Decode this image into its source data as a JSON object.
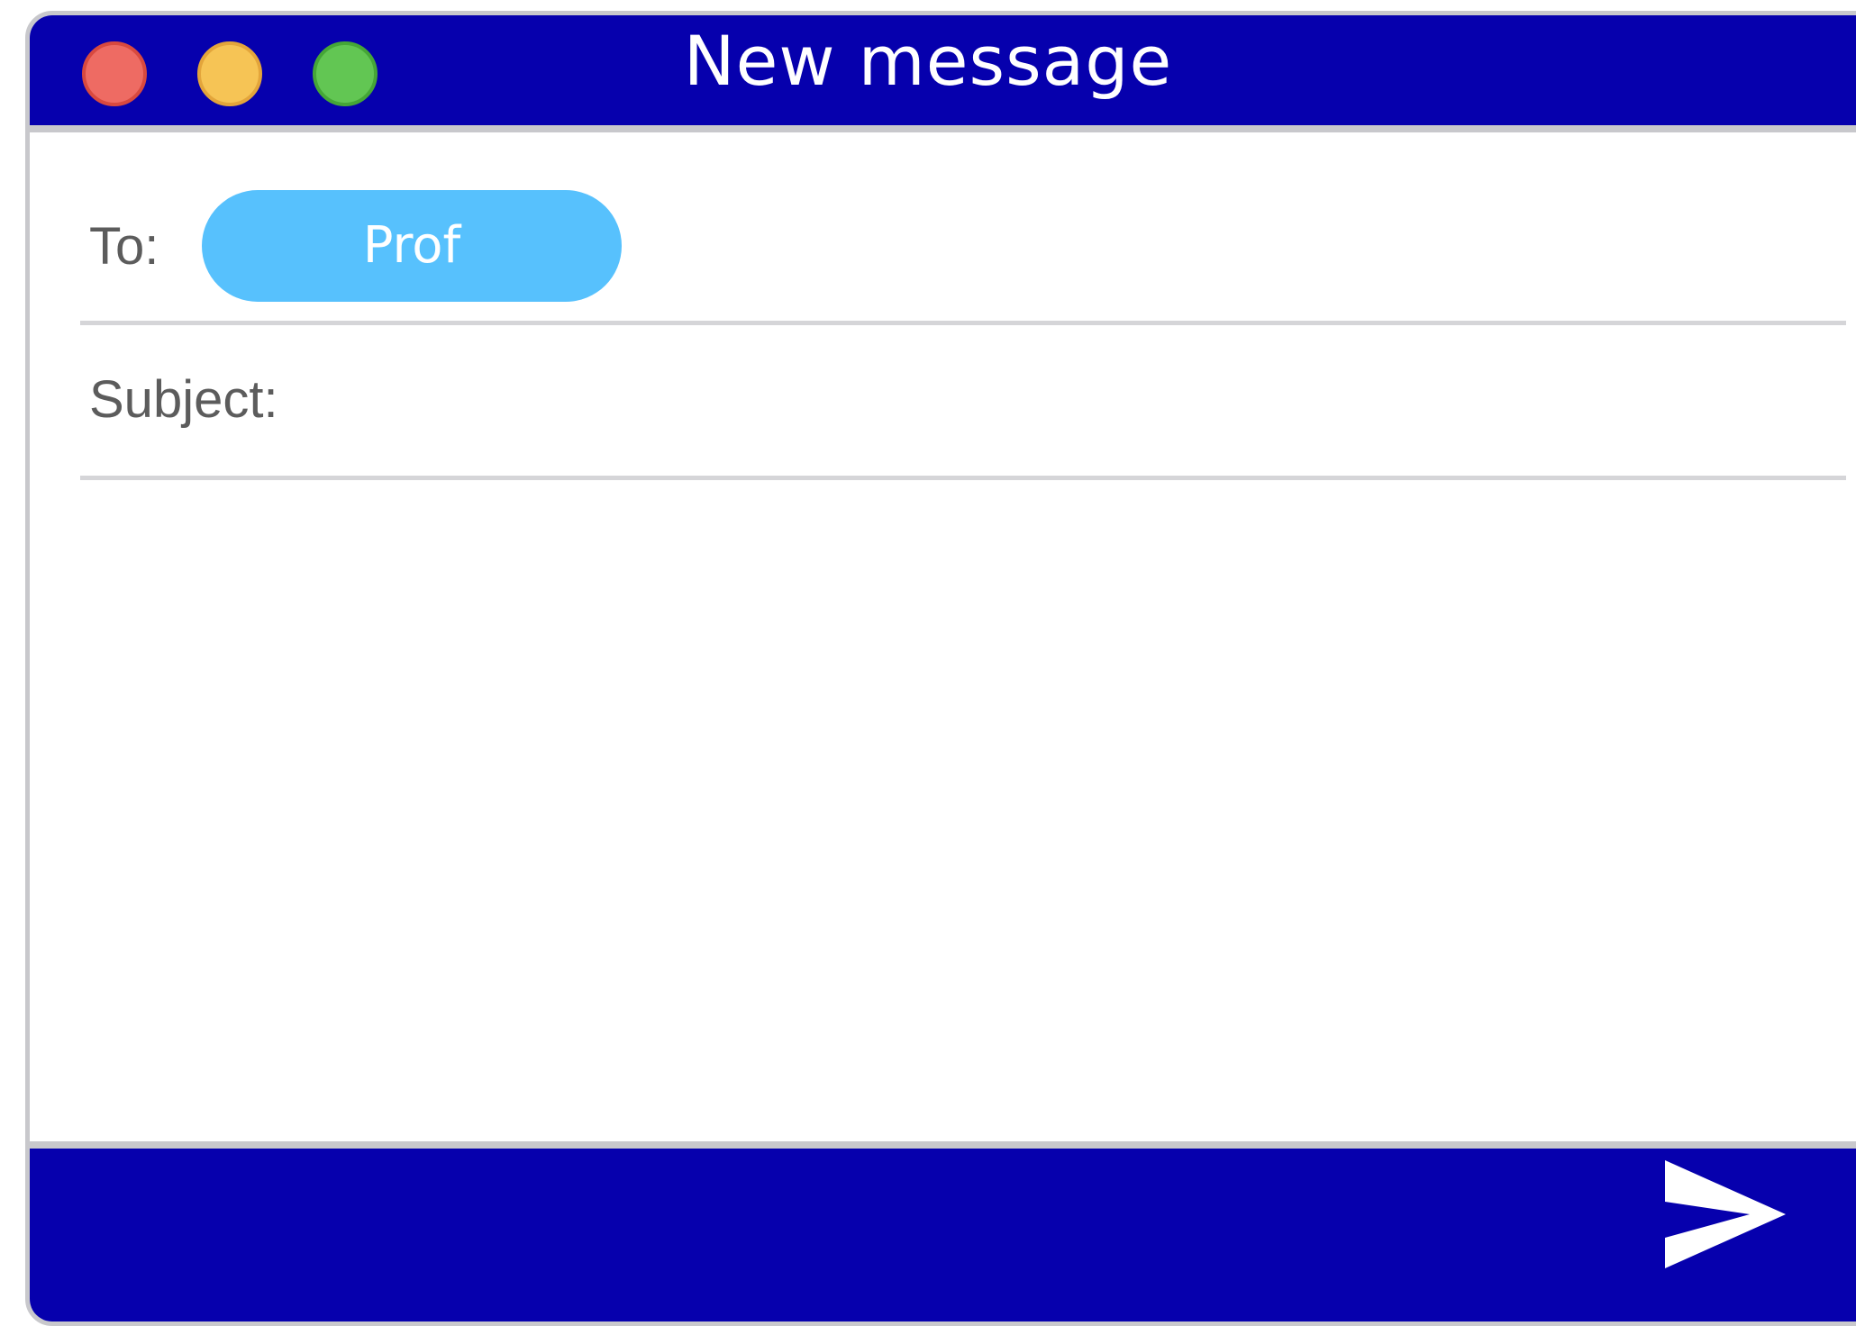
{
  "window": {
    "title": "New message",
    "controls": [
      "close",
      "minimize",
      "zoom"
    ]
  },
  "compose": {
    "to_label": "To:",
    "recipient": "Prof",
    "subject_label": "Subject:",
    "subject_value": "",
    "body_value": ""
  },
  "footer": {
    "send_icon": "send-icon"
  },
  "colors": {
    "titlebar": "#0600ad",
    "recipient_chip": "#57c1fd",
    "close": "#ee6b63",
    "minimize": "#f6c455",
    "zoom": "#62c653",
    "separator": "#d5d5d8"
  }
}
